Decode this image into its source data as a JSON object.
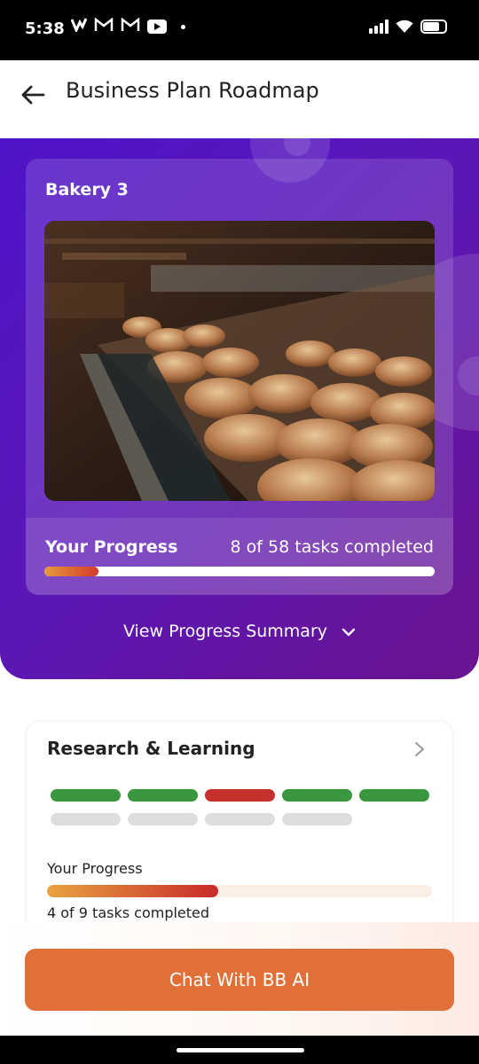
{
  "status_bar": {
    "time": "5:38",
    "notification_icons": [
      "v-logo-icon",
      "gmail-icon",
      "gmail-icon",
      "youtube-icon",
      "dot-icon"
    ],
    "right_icons": [
      "signal-icon",
      "wifi-icon",
      "battery-icon"
    ]
  },
  "header": {
    "title": "Business Plan Roadmap",
    "back_icon": "arrow-left-icon"
  },
  "hero": {
    "plan_name": "Bakery 3",
    "progress_label": "Your Progress",
    "progress_text": "8 of 58 tasks completed",
    "progress_fraction": 0.138,
    "view_summary_label": "View Progress Summary",
    "gradient_colors": [
      "#4f14c8",
      "#6a1490"
    ]
  },
  "section": {
    "title": "Research & Learning",
    "segments": [
      "done",
      "done",
      "error",
      "done",
      "done",
      "todo",
      "todo",
      "todo",
      "todo"
    ],
    "segment_colors": {
      "done": "#3a963f",
      "error": "#c6302d",
      "todo": "#dedede"
    },
    "progress_label": "Your Progress",
    "progress_fraction": 0.444,
    "progress_text": "4 of 9 tasks completed"
  },
  "chat_button": {
    "label": "Chat With BB AI",
    "color": "#e07038"
  }
}
